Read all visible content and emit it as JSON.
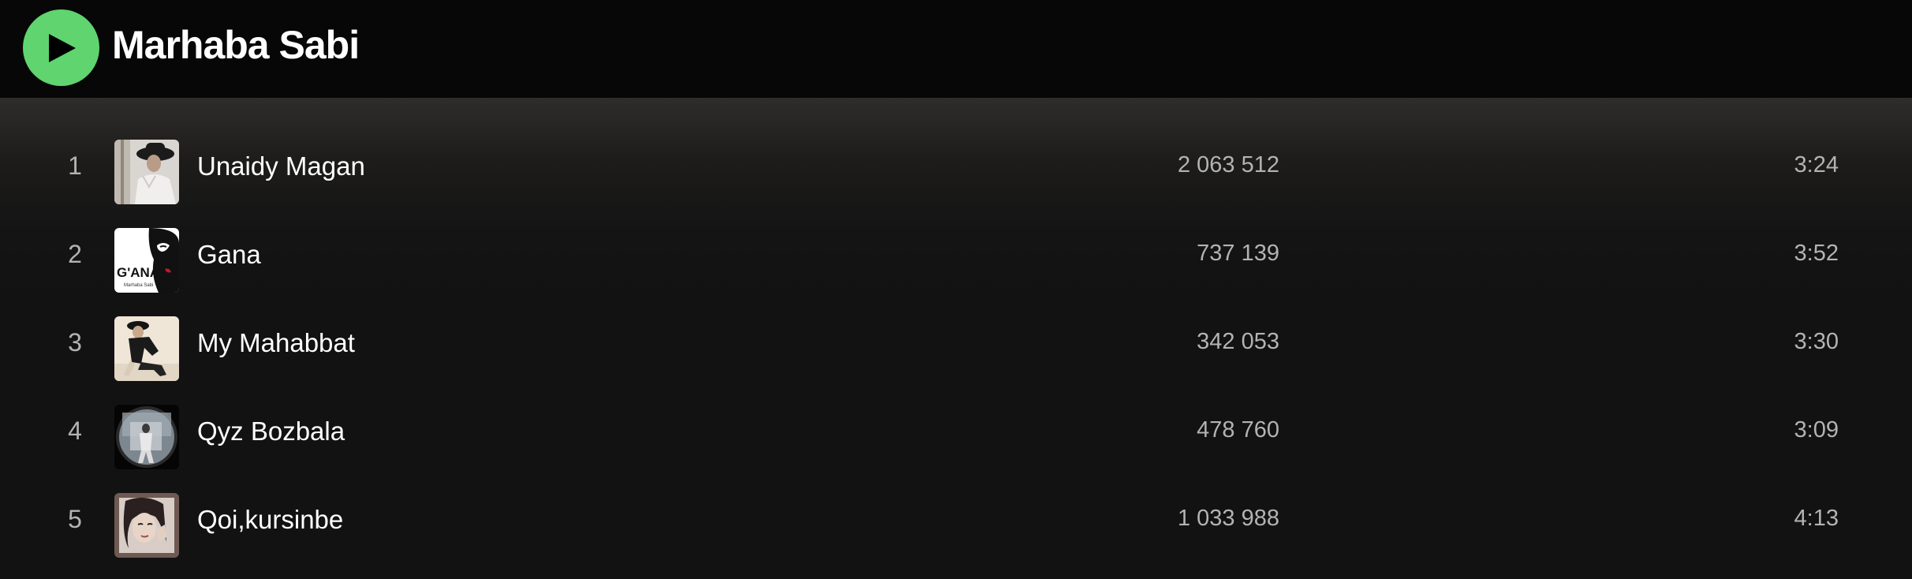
{
  "header": {
    "artist_name": "Marhaba Sabi",
    "play_icon": "play-icon",
    "play_button_color": "#5fd46f"
  },
  "tracks": [
    {
      "number": "1",
      "title": "Unaidy Magan",
      "plays": "2 063 512",
      "duration": "3:24",
      "cover": "cover-photo-woman-hat"
    },
    {
      "number": "2",
      "title": "Gana",
      "plays": "737 139",
      "duration": "3:52",
      "cover": "cover-gana-illustration",
      "cover_text": "G'ANA",
      "cover_subtext": "Marhaba Sabi"
    },
    {
      "number": "3",
      "title": "My Mahabbat",
      "plays": "342 053",
      "duration": "3:30",
      "cover": "cover-photo-posing"
    },
    {
      "number": "4",
      "title": "Qyz Bozbala",
      "plays": "478 760",
      "duration": "3:09",
      "cover": "cover-photo-round-frame"
    },
    {
      "number": "5",
      "title": "Qoi,kursinbe",
      "plays": "1 033 988",
      "duration": "4:13",
      "cover": "cover-photo-portrait"
    }
  ]
}
